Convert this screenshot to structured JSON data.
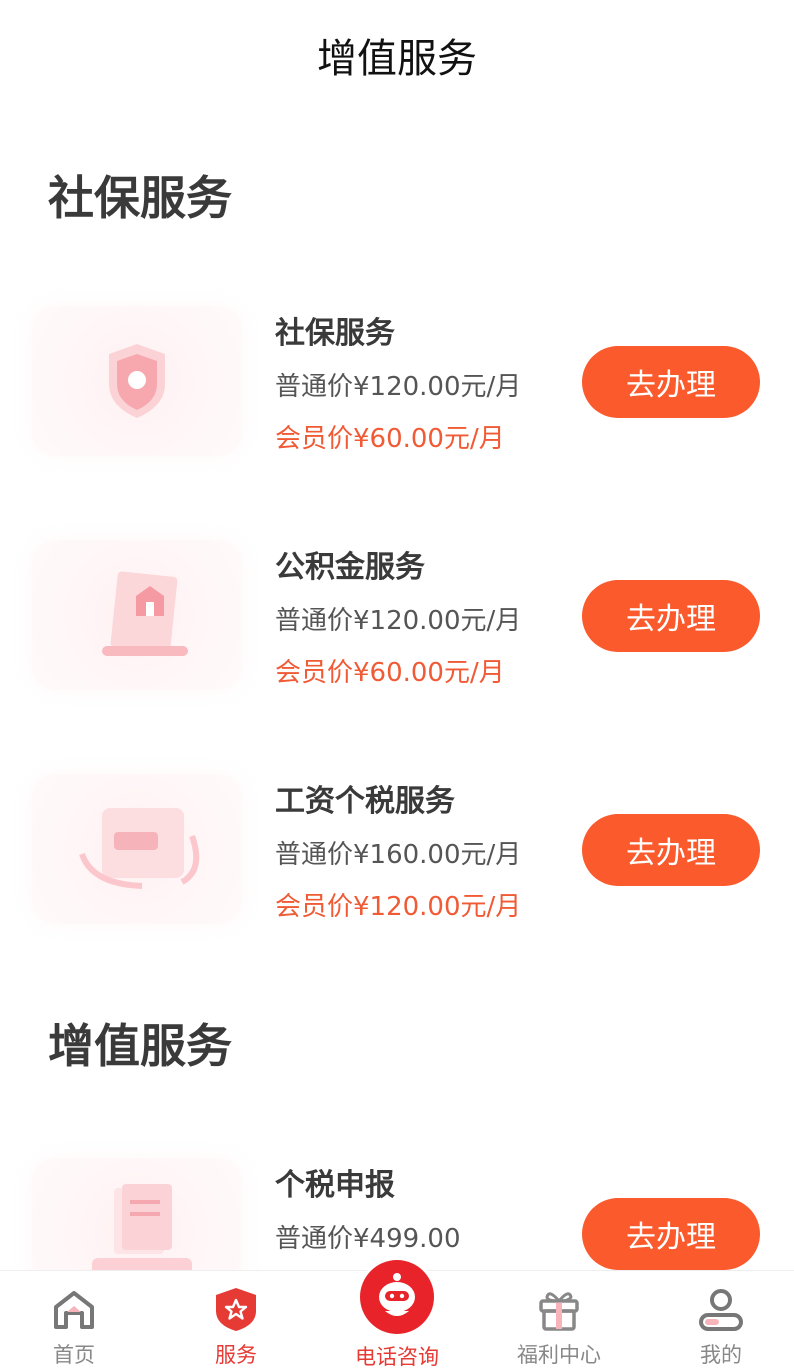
{
  "header": {
    "title": "增值服务"
  },
  "sections": [
    {
      "heading": "社保服务",
      "items": [
        {
          "name": "社保服务",
          "normal_price": "普通价¥120.00元/月",
          "member_price": "会员价¥60.00元/月",
          "button": "去办理",
          "icon": "shield-icon"
        },
        {
          "name": "公积金服务",
          "normal_price": "普通价¥120.00元/月",
          "member_price": "会员价¥60.00元/月",
          "button": "去办理",
          "icon": "house-scroll-icon"
        },
        {
          "name": "工资个税服务",
          "normal_price": "普通价¥160.00元/月",
          "member_price": "会员价¥120.00元/月",
          "button": "去办理",
          "icon": "wallet-icon"
        }
      ]
    },
    {
      "heading": "增值服务",
      "items": [
        {
          "name": "个税申报",
          "normal_price": "普通价¥499.00",
          "button": "去办理",
          "icon": "document-icon"
        }
      ]
    }
  ],
  "tabbar": {
    "items": [
      {
        "label": "首页",
        "icon": "home-icon",
        "active": false
      },
      {
        "label": "服务",
        "icon": "service-shield-icon",
        "active": true
      },
      {
        "label": "电话咨询",
        "icon": "robot-icon",
        "active": false
      },
      {
        "label": "福利中心",
        "icon": "gift-icon",
        "active": false
      },
      {
        "label": "我的",
        "icon": "user-icon",
        "active": false
      }
    ]
  },
  "colors": {
    "accent": "#fb5a2c",
    "member_price": "#f05a35",
    "tab_active": "#e63a35"
  }
}
